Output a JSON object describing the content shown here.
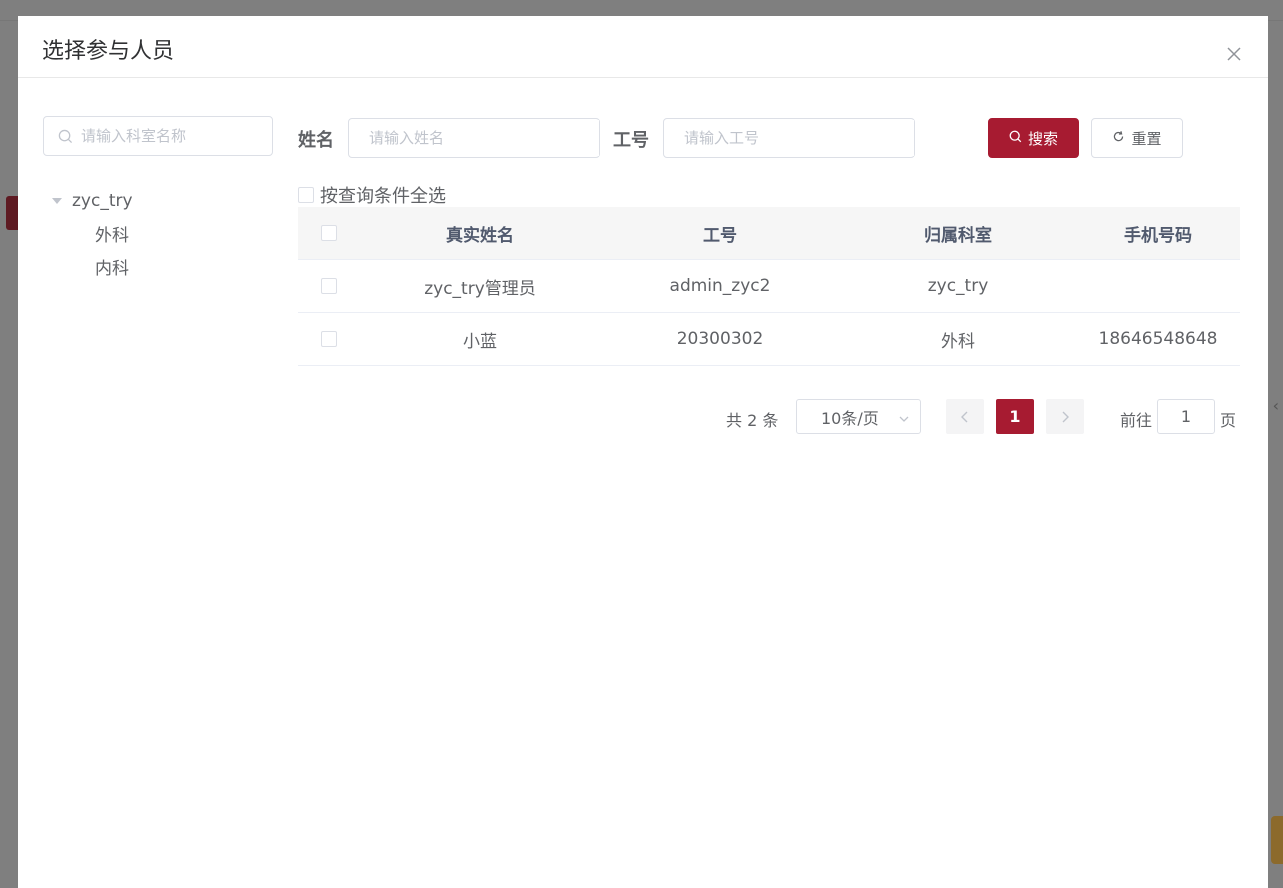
{
  "dialog": {
    "title": "选择参与人员"
  },
  "tree": {
    "search_placeholder": "请输入科室名称",
    "root": "zyc_try",
    "children": [
      "外科",
      "内科"
    ]
  },
  "form": {
    "name_label": "姓名",
    "name_placeholder": "请输入姓名",
    "id_label": "工号",
    "id_placeholder": "请输入工号",
    "search_button": "搜索",
    "reset_button": "重置",
    "select_all_label": "按查询条件全选"
  },
  "table": {
    "headers": [
      "真实姓名",
      "工号",
      "归属科室",
      "手机号码"
    ],
    "rows": [
      [
        "zyc_try管理员",
        "admin_zyc2",
        "zyc_try",
        ""
      ],
      [
        "小蓝",
        "20300302",
        "外科",
        "18646548648"
      ]
    ]
  },
  "pagination": {
    "total_text": "共 2 条",
    "page_size": "10条/页",
    "current_page": "1",
    "goto_label": "前往",
    "goto_value": "1",
    "page_unit": "页"
  },
  "colors": {
    "primary": "#a71b31"
  }
}
